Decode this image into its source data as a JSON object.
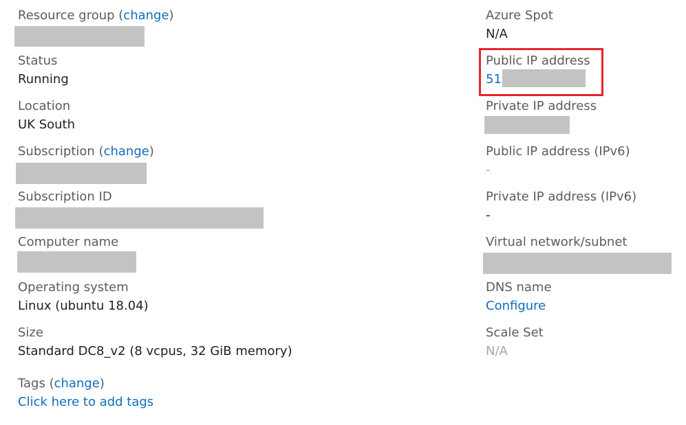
{
  "left": {
    "resource_group": {
      "label": "Resource group",
      "paren_open": " (",
      "change": "change",
      "paren_close": ")"
    },
    "status": {
      "label": "Status",
      "value": "Running"
    },
    "location": {
      "label": "Location",
      "value": "UK South"
    },
    "subscription": {
      "label": "Subscription",
      "paren_open": " (",
      "change": "change",
      "paren_close": ")"
    },
    "subscription_id": {
      "label": "Subscription ID"
    },
    "computer_name": {
      "label": "Computer name"
    },
    "operating_system": {
      "label": "Operating system",
      "value": "Linux (ubuntu 18.04)"
    },
    "size": {
      "label": "Size",
      "value": "Standard DC8_v2 (8 vcpus, 32 GiB memory)"
    },
    "tags": {
      "label": "Tags",
      "paren_open": " (",
      "change": "change",
      "paren_close": ")",
      "add_link": "Click here to add tags"
    }
  },
  "right": {
    "azure_spot": {
      "label": "Azure Spot",
      "value": "N/A"
    },
    "public_ip": {
      "label": "Public IP address",
      "value_prefix": "51."
    },
    "private_ip": {
      "label": "Private IP address"
    },
    "public_ip_v6": {
      "label": "Public IP address (IPv6)",
      "value": "-"
    },
    "private_ip_v6": {
      "label": "Private IP address (IPv6)",
      "value": "-"
    },
    "vnet_subnet": {
      "label": "Virtual network/subnet"
    },
    "dns_name": {
      "label": "DNS name",
      "value": "Configure"
    },
    "scale_set": {
      "label": "Scale Set",
      "value": "N/A"
    }
  },
  "colors": {
    "link": "#0f6cbd",
    "label": "#5c5c5c",
    "value": "#1f1f1f",
    "muted": "#a6a6a6",
    "redaction": "#c3c3c3",
    "highlight": "#e8242f"
  }
}
